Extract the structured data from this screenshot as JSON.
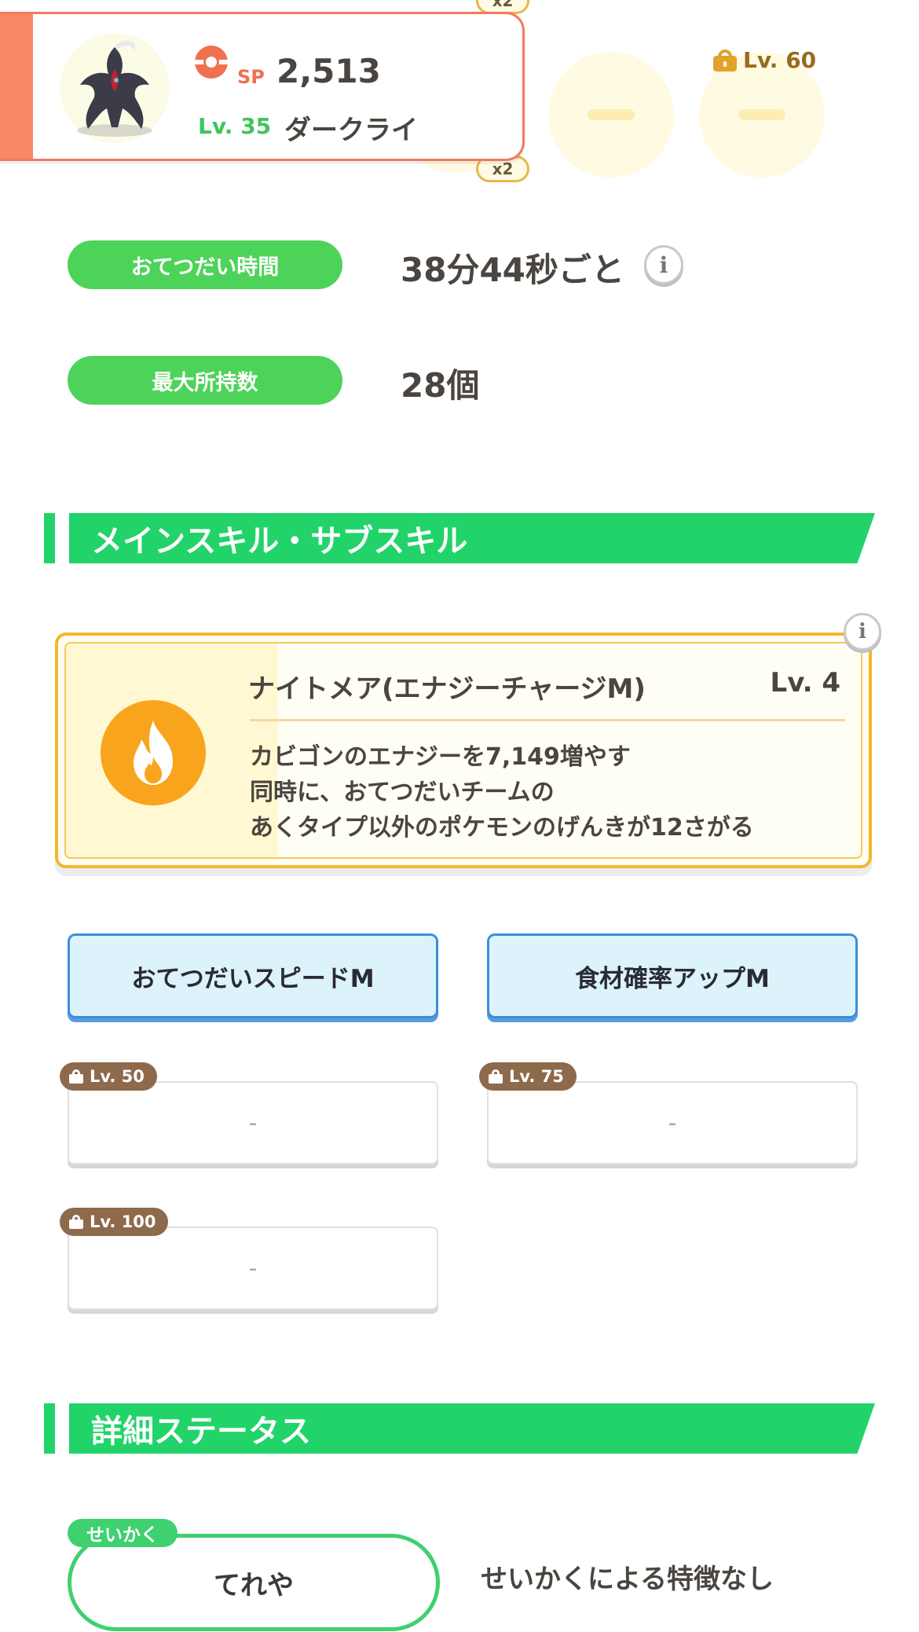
{
  "ingredients": {
    "qty_top": "x2",
    "qty_bottom": "x2",
    "unlock_level": "Lv. 60"
  },
  "pokemon": {
    "sp_label": "SP",
    "sp_value": "2,513",
    "level": "Lv. 35",
    "name": "ダークライ"
  },
  "stats": {
    "help_time_label": "おてつだい時間",
    "help_time_value": "38分44秒ごと",
    "max_carry_label": "最大所持数",
    "max_carry_value": "28個",
    "info_glyph": "i"
  },
  "skills_section": {
    "title": "メインスキル・サブスキル",
    "main_skill": {
      "name": "ナイトメア(エナジーチャージM)",
      "level": "Lv. 4",
      "icon": "fire-icon",
      "description": [
        "カビゴンのエナジーを7,149増やす",
        "同時に、おてつだいチームの",
        "あくタイプ以外のポケモンのげんきが12さがる"
      ]
    },
    "sub_skills": [
      {
        "label": "おてつだいスピードM"
      },
      {
        "label": "食材確率アップM"
      }
    ],
    "locked_slots": [
      {
        "level": "Lv. 50",
        "value": "-"
      },
      {
        "level": "Lv. 75",
        "value": "-"
      },
      {
        "level": "Lv. 100",
        "value": "-"
      }
    ]
  },
  "details_section": {
    "title": "詳細ステータス",
    "nature_tag": "せいかく",
    "nature_value": "てれや",
    "nature_effect": "せいかくによる特徴なし"
  },
  "colors": {
    "accent_green": "#22d36a",
    "card_coral": "#f27a60",
    "skill_gold": "#f5b52e",
    "subskill_blue": "#3b8fd8",
    "lock_brown": "#8d6a4b"
  }
}
